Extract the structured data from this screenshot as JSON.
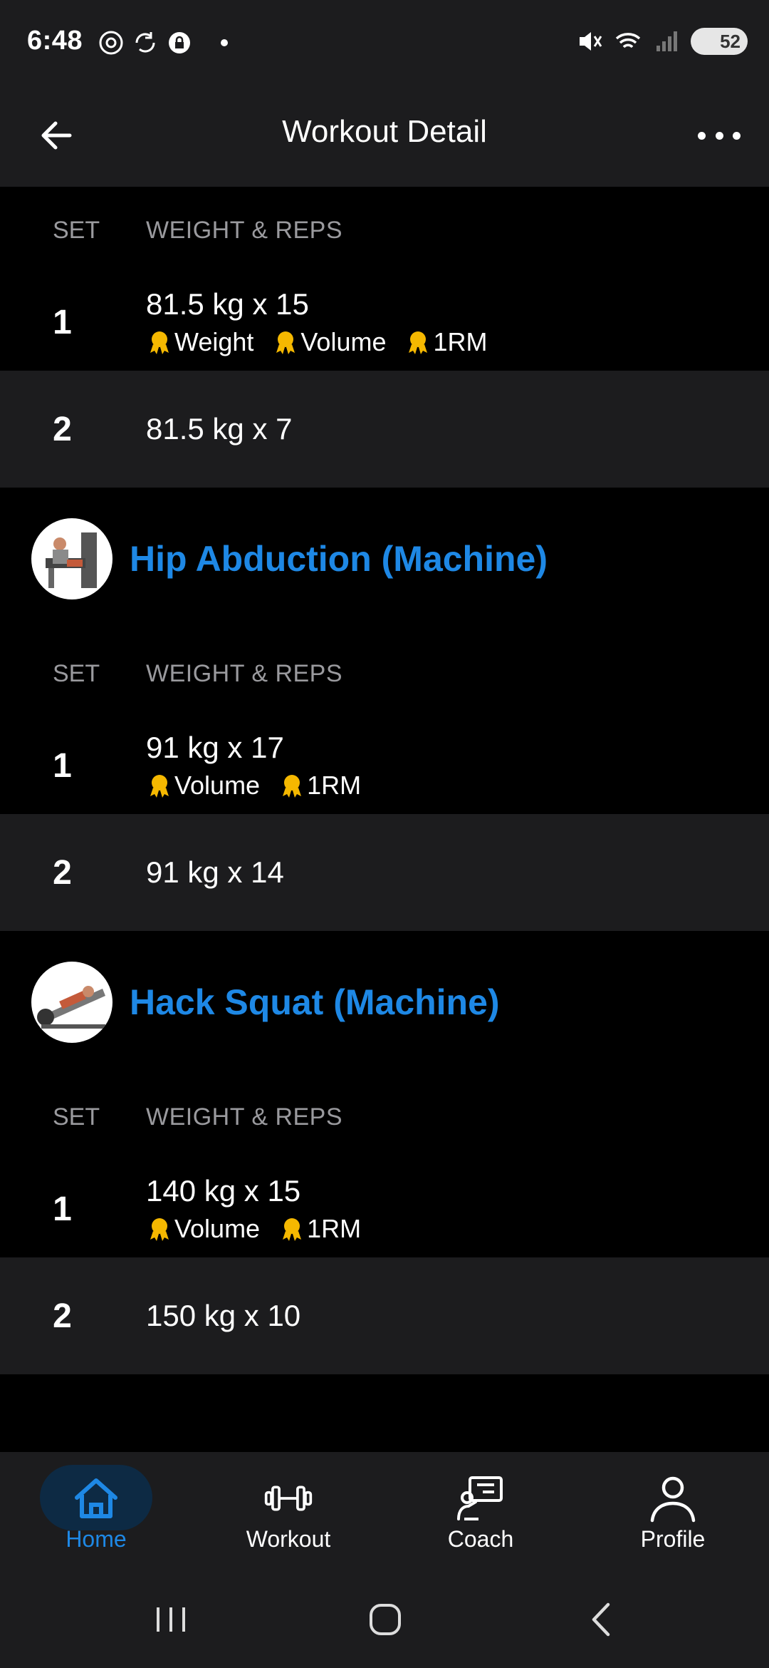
{
  "status_bar": {
    "time": "6:48",
    "battery": "52"
  },
  "header": {
    "title": "Workout Detail"
  },
  "columns": {
    "set": "SET",
    "weight_reps": "WEIGHT & REPS"
  },
  "top_sets": [
    {
      "num": "1",
      "value": "81.5 kg x 15",
      "prs": [
        "Weight",
        "Volume",
        "1RM"
      ]
    },
    {
      "num": "2",
      "value": "81.5 kg x 7",
      "prs": []
    }
  ],
  "exercises": [
    {
      "name": "Hip Abduction (Machine)",
      "sets": [
        {
          "num": "1",
          "value": "91 kg x 17",
          "prs": [
            "Volume",
            "1RM"
          ]
        },
        {
          "num": "2",
          "value": "91 kg x 14",
          "prs": []
        }
      ]
    },
    {
      "name": "Hack Squat (Machine)",
      "sets": [
        {
          "num": "1",
          "value": "140 kg x 15",
          "prs": [
            "Volume",
            "1RM"
          ]
        },
        {
          "num": "2",
          "value": "150 kg x 10",
          "prs": []
        }
      ]
    }
  ],
  "bottom_nav": [
    {
      "label": "Home",
      "icon": "home-icon",
      "active": true
    },
    {
      "label": "Workout",
      "icon": "dumbbell-icon",
      "active": false
    },
    {
      "label": "Coach",
      "icon": "coach-icon",
      "active": false
    },
    {
      "label": "Profile",
      "icon": "profile-icon",
      "active": false
    }
  ],
  "colors": {
    "accent": "#1e88e5",
    "medal": "#f5b800",
    "background": "#000000",
    "surface": "#1c1c1e"
  }
}
